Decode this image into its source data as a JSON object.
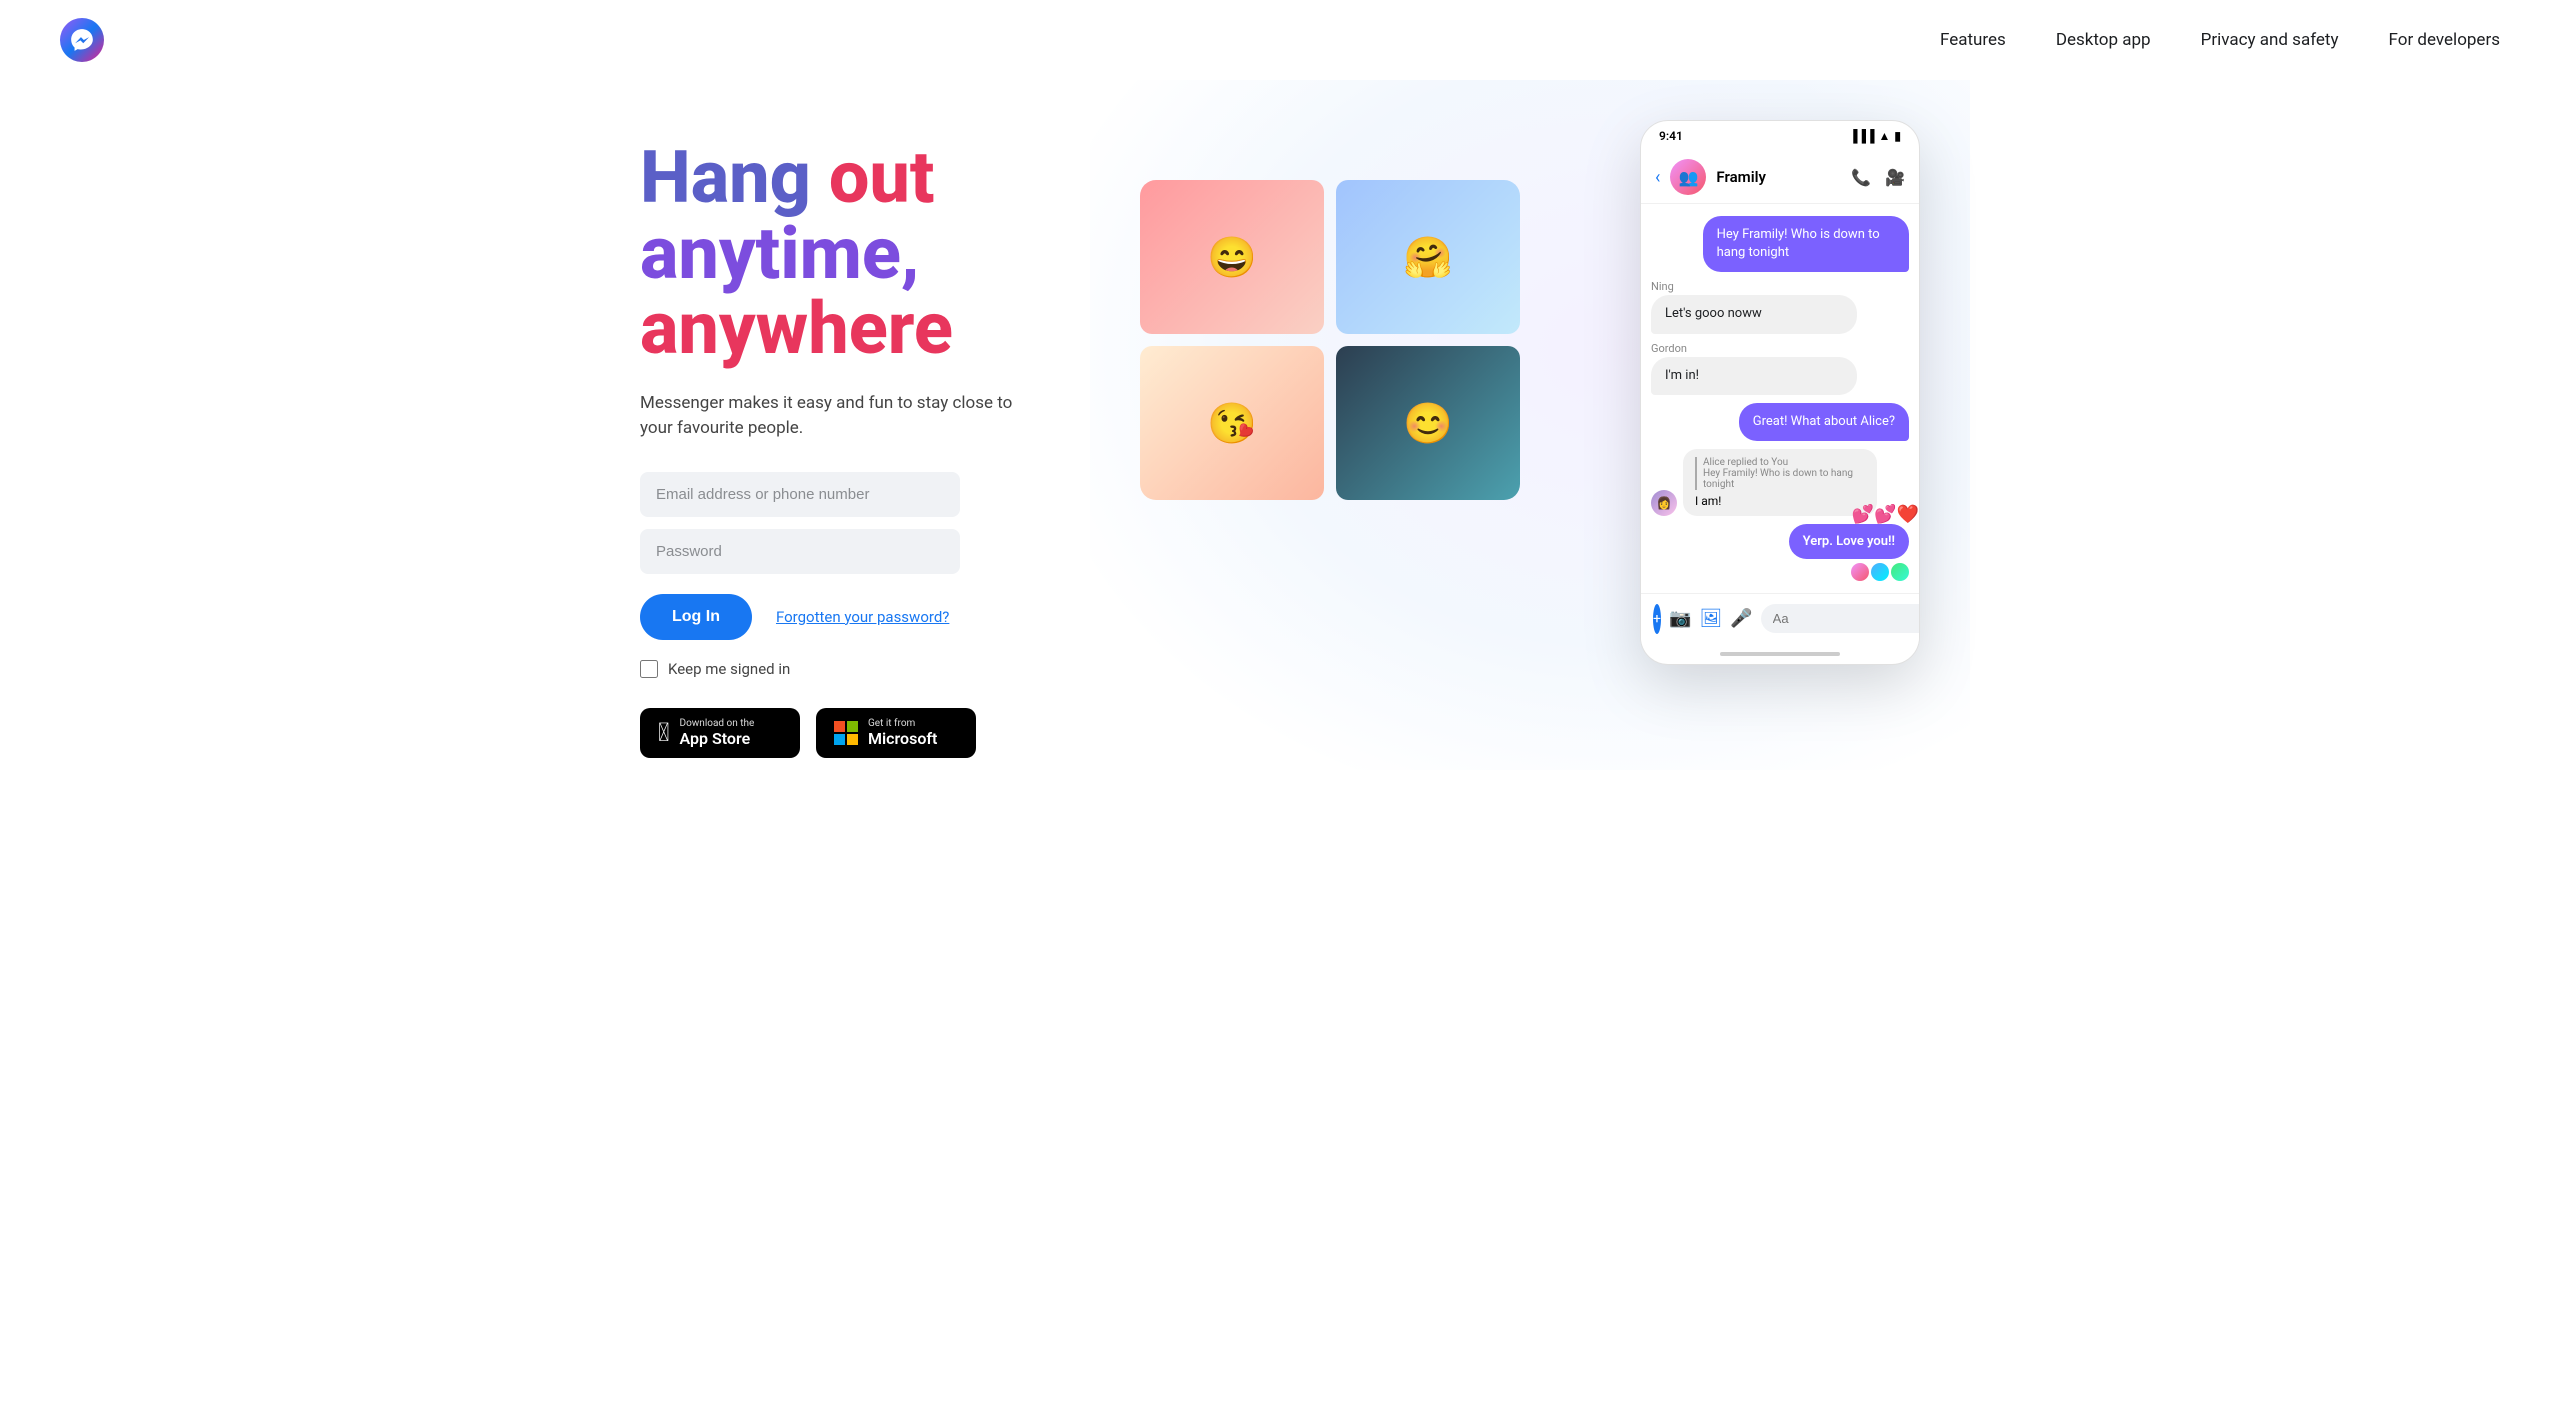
{
  "nav": {
    "logo_label": "Messenger",
    "links": [
      {
        "label": "Features",
        "href": "#"
      },
      {
        "label": "Desktop app",
        "href": "#"
      },
      {
        "label": "Privacy and safety",
        "href": "#"
      },
      {
        "label": "For developers",
        "href": "#"
      }
    ]
  },
  "hero": {
    "line1_word1": "Hang",
    "line1_word2": "out",
    "line2_word1": "anytime,",
    "line3_word1": "anywhere",
    "subtitle": "Messenger makes it easy and fun to stay close to your favourite people."
  },
  "form": {
    "email_placeholder": "Email address or phone number",
    "password_placeholder": "Password",
    "login_label": "Log In",
    "forgot_label": "Forgotten your password?",
    "keep_signed_label": "Keep me signed in"
  },
  "app_stores": {
    "apple_small": "Download on the",
    "apple_big": "App Store",
    "microsoft_small": "Get it from",
    "microsoft_big": "Microsoft"
  },
  "phone": {
    "time": "9:41",
    "contact_name": "Framily",
    "messages": [
      {
        "type": "sent",
        "text": "Hey Framily! Who is down to hang tonight"
      },
      {
        "type": "received",
        "sender": "Ning",
        "text": "Let's gooo noww"
      },
      {
        "type": "received",
        "sender": "Gordon",
        "text": "I'm in!"
      },
      {
        "type": "sent",
        "text": "Great! What about Alice?"
      },
      {
        "type": "reply",
        "replyTo": "Alice replied to You",
        "replyText": "Hey Framily! Who is down to hang tonight",
        "text": "I am!"
      },
      {
        "type": "sent_hearts",
        "text": "Yerp. Love you!!"
      }
    ],
    "input_placeholder": "Aa"
  }
}
